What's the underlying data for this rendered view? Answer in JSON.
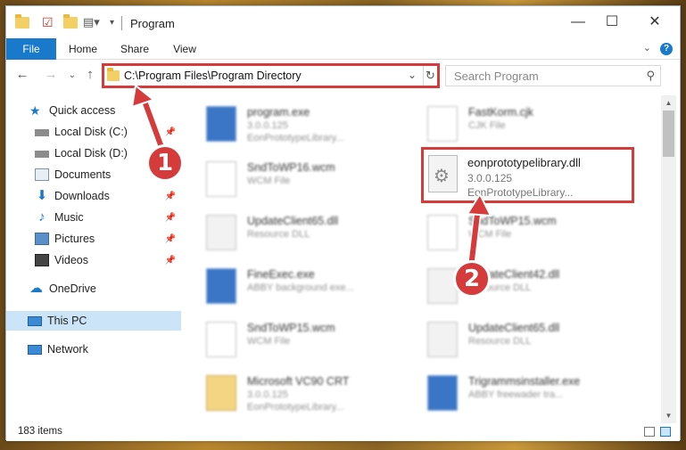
{
  "window": {
    "title": "Program"
  },
  "ribbon": {
    "tabs": [
      "File",
      "Home",
      "Share",
      "View"
    ]
  },
  "address": {
    "path": "C:\\Program Files\\Program Directory"
  },
  "search": {
    "placeholder": "Search Program"
  },
  "sidebar": {
    "items": [
      {
        "label": "Quick access"
      },
      {
        "label": "Local Disk (C:)"
      },
      {
        "label": "Local Disk (D:)"
      },
      {
        "label": "Documents"
      },
      {
        "label": "Downloads"
      },
      {
        "label": "Music"
      },
      {
        "label": "Pictures"
      },
      {
        "label": "Videos"
      },
      {
        "label": "OneDrive"
      },
      {
        "label": "This PC"
      },
      {
        "label": "Network"
      }
    ]
  },
  "files": [
    {
      "name": "program.exe",
      "sub": "3.0.0.125",
      "sub2": "EonPrototypeLibrary..."
    },
    {
      "name": "FastKorm.cjk",
      "sub": "CJK File",
      "sub2": ""
    },
    {
      "name": "SndToWP16.wcm",
      "sub": "WCM File",
      "sub2": ""
    },
    {
      "name": "UpdateClient65.dll",
      "sub": "Resource DLL",
      "sub2": ""
    },
    {
      "name": "SndToWP15.wcm",
      "sub": "WCM File",
      "sub2": ""
    },
    {
      "name": "FineExec.exe",
      "sub": "ABBY background exe...",
      "sub2": ""
    },
    {
      "name": "UpdateClient42.dll",
      "sub": "Resource DLL",
      "sub2": ""
    },
    {
      "name": "SndToWP15.wcm",
      "sub": "WCM File",
      "sub2": ""
    },
    {
      "name": "UpdateClient65.dll",
      "sub": "Resource DLL",
      "sub2": ""
    },
    {
      "name": "Microsoft VC90 CRT",
      "sub": "3.0.0.125",
      "sub2": "EonPrototypeLibrary..."
    },
    {
      "name": "Trigrammsinstaller.exe",
      "sub": "ABBY freewader tra...",
      "sub2": ""
    }
  ],
  "highlighted_file": {
    "name": "eonprototypelibrary.dll",
    "version": "3.0.0.125",
    "description": "EonPrototypeLibrary..."
  },
  "annotations": {
    "step1": "1",
    "step2": "2"
  },
  "status": {
    "item_count": "183 items"
  },
  "colors": {
    "accent": "#1979ca",
    "highlight": "#d63b3b",
    "selected_nav": "#cce4f7"
  }
}
